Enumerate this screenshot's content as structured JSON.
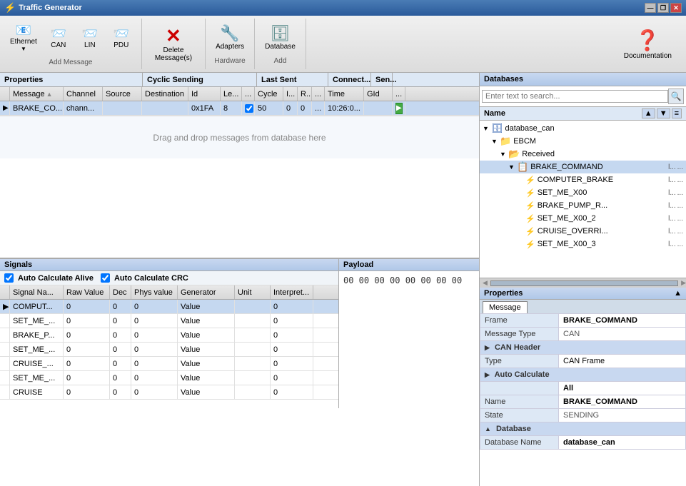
{
  "titleBar": {
    "icon": "⚡",
    "title": "Traffic Generator",
    "minBtn": "—",
    "restoreBtn": "❐",
    "closeBtn": "✕"
  },
  "toolbar": {
    "groups": [
      {
        "label": "Add Message",
        "buttons": [
          {
            "id": "ethernet",
            "icon": "📧",
            "label": "Ethernet",
            "hasArrow": true
          },
          {
            "id": "can",
            "icon": "📨",
            "label": "CAN",
            "hasArrow": false
          },
          {
            "id": "lin",
            "icon": "📨",
            "label": "LIN",
            "hasArrow": false
          },
          {
            "id": "pdu",
            "icon": "📨",
            "label": "PDU",
            "hasArrow": false
          }
        ]
      },
      {
        "label": "",
        "buttons": [
          {
            "id": "delete",
            "icon": "✕",
            "label": "Delete\nMessage(s)"
          }
        ]
      },
      {
        "label": "Hardware",
        "buttons": [
          {
            "id": "adapters",
            "icon": "🔧",
            "label": "Adapters"
          }
        ]
      },
      {
        "label": "Add",
        "buttons": [
          {
            "id": "database",
            "icon": "🗄",
            "label": "Database"
          }
        ]
      }
    ],
    "doc": {
      "label": "Documentation"
    }
  },
  "messageTable": {
    "sectionHeaders": [
      {
        "label": "Properties",
        "span": 3
      },
      {
        "label": "Cyclic Sending",
        "span": 4
      },
      {
        "label": "Last Sent",
        "span": 3
      },
      {
        "label": "Connect...",
        "span": 1
      },
      {
        "label": "Sen...",
        "span": 1
      }
    ],
    "columns": [
      {
        "label": "Message",
        "width": 75
      },
      {
        "label": "Channel",
        "width": 55
      },
      {
        "label": "Source",
        "width": 55
      },
      {
        "label": "Destination",
        "width": 65
      },
      {
        "label": "Id",
        "width": 45
      },
      {
        "label": "Le...",
        "width": 30
      },
      {
        "label": "...",
        "width": 18
      },
      {
        "label": "Cycle",
        "width": 40
      },
      {
        "label": "I...",
        "width": 20
      },
      {
        "label": "R...",
        "width": 20
      },
      {
        "label": "...",
        "width": 18
      },
      {
        "label": "Time",
        "width": 55
      },
      {
        "label": "GId",
        "width": 40
      },
      {
        "label": "...",
        "width": 18
      }
    ],
    "rows": [
      {
        "selected": true,
        "message": "BRAKE_CO...",
        "channel": "chann...",
        "source": "",
        "destination": "",
        "id": "0x1FA",
        "len": "8",
        "checked": true,
        "cycle": "50",
        "i": "0",
        "r": "0",
        "dots": "...",
        "time": "10:26:0...",
        "gid": "",
        "extra": ""
      }
    ],
    "dragDropText": "Drag and drop messages from database here"
  },
  "signals": {
    "header": "Signals",
    "autoAlive": "Auto Calculate Alive",
    "autoCRC": "Auto Calculate CRC",
    "columns": [
      {
        "label": "Signal Na...",
        "width": 75
      },
      {
        "label": "Raw Value",
        "width": 65
      },
      {
        "label": "Dec",
        "width": 30
      },
      {
        "label": "Phys value",
        "width": 65
      },
      {
        "label": "Generator",
        "width": 80
      },
      {
        "label": "Unit",
        "width": 50
      },
      {
        "label": "Interpret...",
        "width": 60
      }
    ],
    "rows": [
      {
        "name": "COMPUT...",
        "raw": "0",
        "dec": "0",
        "phys": "0",
        "gen": "Value",
        "unit": "",
        "interp": "0",
        "selected": true
      },
      {
        "name": "SET_ME_...",
        "raw": "0",
        "dec": "0",
        "phys": "0",
        "gen": "Value",
        "unit": "",
        "interp": "0"
      },
      {
        "name": "BRAKE_P...",
        "raw": "0",
        "dec": "0",
        "phys": "0",
        "gen": "Value",
        "unit": "",
        "interp": "0"
      },
      {
        "name": "SET_ME_...",
        "raw": "0",
        "dec": "0",
        "phys": "0",
        "gen": "Value",
        "unit": "",
        "interp": "0"
      },
      {
        "name": "CRUISE_...",
        "raw": "0",
        "dec": "0",
        "phys": "0",
        "gen": "Value",
        "unit": "",
        "interp": "0"
      },
      {
        "name": "SET_ME_...",
        "raw": "0",
        "dec": "0",
        "phys": "0",
        "gen": "Value",
        "unit": "",
        "interp": "0"
      },
      {
        "name": "CRUISE",
        "raw": "0",
        "dec": "0",
        "phys": "0",
        "gen": "Value",
        "unit": "",
        "interp": "0"
      }
    ]
  },
  "payload": {
    "header": "Payload",
    "bytes": "00 00 00 00 00 00 00 00"
  },
  "databases": {
    "header": "Databases",
    "searchPlaceholder": "Enter text to search...",
    "nameHeader": "Name",
    "tree": [
      {
        "level": 0,
        "type": "db",
        "label": "database_can",
        "icon": "🗄",
        "toggle": "▼"
      },
      {
        "level": 1,
        "type": "folder",
        "label": "EBCM",
        "icon": "📁",
        "toggle": "▼"
      },
      {
        "level": 2,
        "type": "folder",
        "label": "Received",
        "icon": "📂",
        "toggle": "▼"
      },
      {
        "level": 3,
        "type": "msg",
        "label": "BRAKE_COMMAND",
        "icon": "📋",
        "toggle": "▼",
        "extra": "l...",
        "extra2": "...",
        "selected": true
      },
      {
        "level": 4,
        "type": "sig",
        "label": "COMPUTER_BRAKE",
        "icon": "⚡",
        "toggle": "",
        "extra": "l...",
        "extra2": "..."
      },
      {
        "level": 4,
        "type": "sig",
        "label": "SET_ME_X00",
        "icon": "⚡",
        "toggle": "",
        "extra": "l...",
        "extra2": "..."
      },
      {
        "level": 4,
        "type": "sig",
        "label": "BRAKE_PUMP_R...",
        "icon": "⚡",
        "toggle": "",
        "extra": "l...",
        "extra2": "..."
      },
      {
        "level": 4,
        "type": "sig",
        "label": "SET_ME_X00_2",
        "icon": "⚡",
        "toggle": "",
        "extra": "l...",
        "extra2": "..."
      },
      {
        "level": 4,
        "type": "sig",
        "label": "CRUISE_OVERRI...",
        "icon": "⚡",
        "toggle": "",
        "extra": "l...",
        "extra2": "..."
      },
      {
        "level": 4,
        "type": "sig",
        "label": "SET_ME_X00_3",
        "icon": "⚡",
        "toggle": "",
        "extra": "l...",
        "extra2": "..."
      }
    ]
  },
  "properties": {
    "header": "Properties",
    "tab": "Message",
    "rows": [
      {
        "label": "Frame",
        "value": "BRAKE_COMMAND",
        "bold": true
      },
      {
        "label": "Message Type",
        "value": "CAN",
        "bold": false
      },
      {
        "label": "section_can",
        "isSection": true,
        "value": "CAN Header"
      },
      {
        "label": "Type",
        "value": "CAN Frame",
        "bold": false
      },
      {
        "label": "section_auto",
        "isSection": true,
        "value": "Auto Calculate"
      },
      {
        "label": "",
        "value": "All",
        "bold": true
      },
      {
        "label": "Name",
        "value": "BRAKE_COMMAND",
        "bold": true
      },
      {
        "label": "State",
        "value": "SENDING",
        "bold": false
      },
      {
        "label": "section_db",
        "isSection": true,
        "value": "Database"
      },
      {
        "label": "Database Name",
        "value": "database_can",
        "bold": true
      }
    ]
  }
}
